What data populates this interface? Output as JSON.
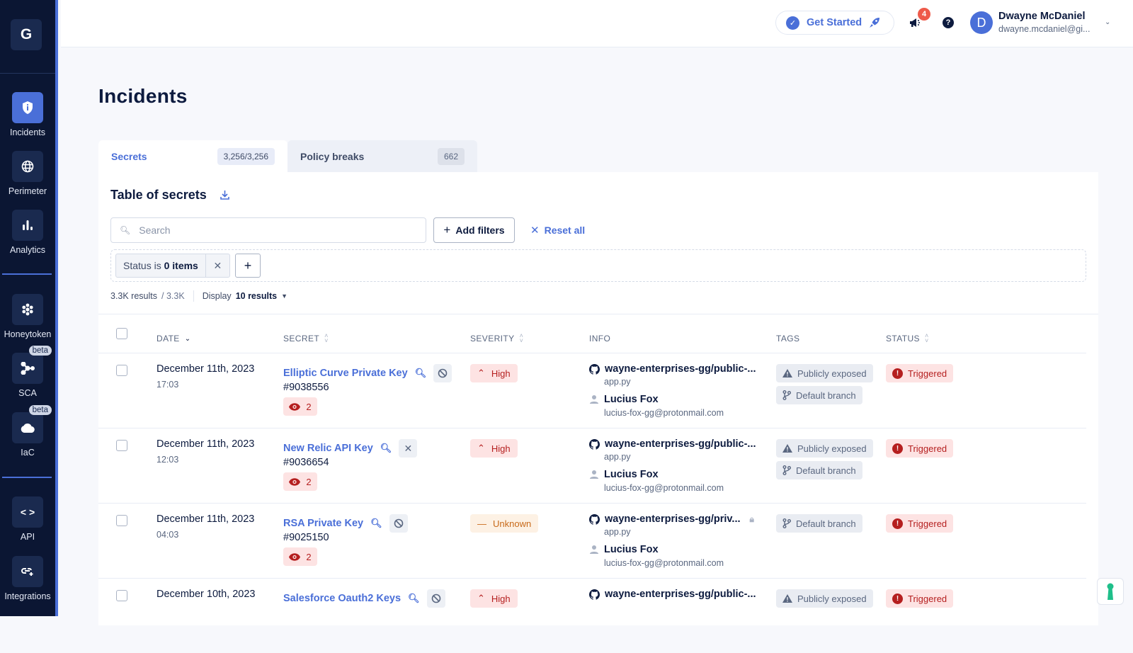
{
  "sidebar": {
    "logo": "G",
    "items": [
      {
        "label": "Incidents",
        "icon": "shield-info-icon",
        "active": true
      },
      {
        "label": "Perimeter",
        "icon": "globe-icon"
      },
      {
        "label": "Analytics",
        "icon": "bar-chart-icon"
      },
      {
        "label": "Honeytoken",
        "icon": "honeycomb-icon"
      },
      {
        "label": "SCA",
        "icon": "nodes-icon",
        "badge": "beta"
      },
      {
        "label": "IaC",
        "icon": "cloud-icon",
        "badge": "beta"
      },
      {
        "label": "API",
        "icon": "code-icon"
      },
      {
        "label": "Integrations",
        "icon": "link-plus-icon"
      }
    ]
  },
  "topbar": {
    "get_started": "Get Started",
    "notifications_count": "4",
    "user": {
      "initial": "D",
      "name": "Dwayne McDaniel",
      "email": "dwayne.mcdaniel@gi..."
    }
  },
  "page": {
    "title": "Incidents"
  },
  "tabs": [
    {
      "label": "Secrets",
      "count": "3,256/3,256",
      "active": true
    },
    {
      "label": "Policy breaks",
      "count": "662",
      "active": false
    }
  ],
  "table_card": {
    "title": "Table of secrets",
    "search_placeholder": "Search",
    "add_filters": "Add filters",
    "reset_all": "Reset all",
    "filter_chip": {
      "prefix": "Status is",
      "value": "0 items"
    },
    "results": {
      "count": "3.3K results",
      "total": "/ 3.3K",
      "display_label": "Display",
      "display_value": "10 results"
    },
    "columns": [
      "DATE",
      "SECRET",
      "SEVERITY",
      "INFO",
      "TAGS",
      "STATUS"
    ]
  },
  "rows": [
    {
      "date": "December 11th, 2023",
      "time": "17:03",
      "secret": "Elliptic Curve Private Key",
      "action": "ignore",
      "id": "#9038556",
      "occurrences": "2",
      "severity": "High",
      "repo": "wayne-enterprises-gg/public-...",
      "private": false,
      "file": "app.py",
      "developer": "Lucius Fox",
      "email": "lucius-fox-gg@protonmail.com",
      "tags": [
        "Publicly exposed",
        "Default branch"
      ],
      "status": "Triggered"
    },
    {
      "date": "December 11th, 2023",
      "time": "12:03",
      "secret": "New Relic API Key",
      "action": "close",
      "id": "#9036654",
      "occurrences": "2",
      "severity": "High",
      "repo": "wayne-enterprises-gg/public-...",
      "private": false,
      "file": "app.py",
      "developer": "Lucius Fox",
      "email": "lucius-fox-gg@protonmail.com",
      "tags": [
        "Publicly exposed",
        "Default branch"
      ],
      "status": "Triggered"
    },
    {
      "date": "December 11th, 2023",
      "time": "04:03",
      "secret": "RSA Private Key",
      "action": "ignore",
      "id": "#9025150",
      "occurrences": "2",
      "severity": "Unknown",
      "repo": "wayne-enterprises-gg/priv...",
      "private": true,
      "file": "app.py",
      "developer": "Lucius Fox",
      "email": "lucius-fox-gg@protonmail.com",
      "tags": [
        "Default branch"
      ],
      "status": "Triggered"
    },
    {
      "date": "December 10th, 2023",
      "time": "",
      "secret": "Salesforce Oauth2 Keys",
      "action": "ignore",
      "id": "",
      "occurrences": "",
      "severity": "High",
      "repo": "wayne-enterprises-gg/public-...",
      "private": false,
      "file": "",
      "developer": "",
      "email": "",
      "tags": [
        "Publicly exposed"
      ],
      "status": "Triggered"
    }
  ],
  "colors": {
    "accent": "#4a6fd8",
    "sidebar": "#0b1633",
    "danger": "#b51f1f",
    "warning": "#c86a1a",
    "brand_green": "#1fbf8a"
  }
}
